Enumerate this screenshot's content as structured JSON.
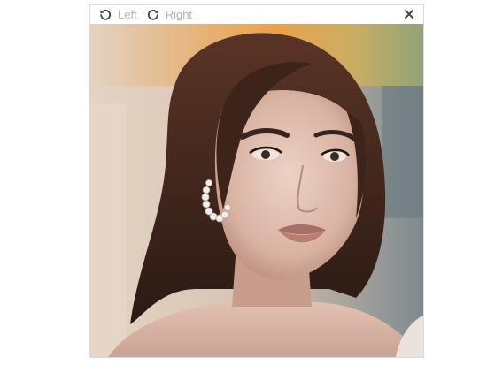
{
  "toolbar": {
    "rotate_left_label": "Left",
    "rotate_right_label": "Right",
    "rotate_left_icon": "rotate-left-icon",
    "rotate_right_icon": "rotate-right-icon",
    "close_icon": "close-icon"
  },
  "image": {
    "subject": "portrait-photo"
  },
  "colors": {
    "accent_marker": "#f26b1d",
    "label_text": "#b3b3b3",
    "icon": "#444444"
  }
}
